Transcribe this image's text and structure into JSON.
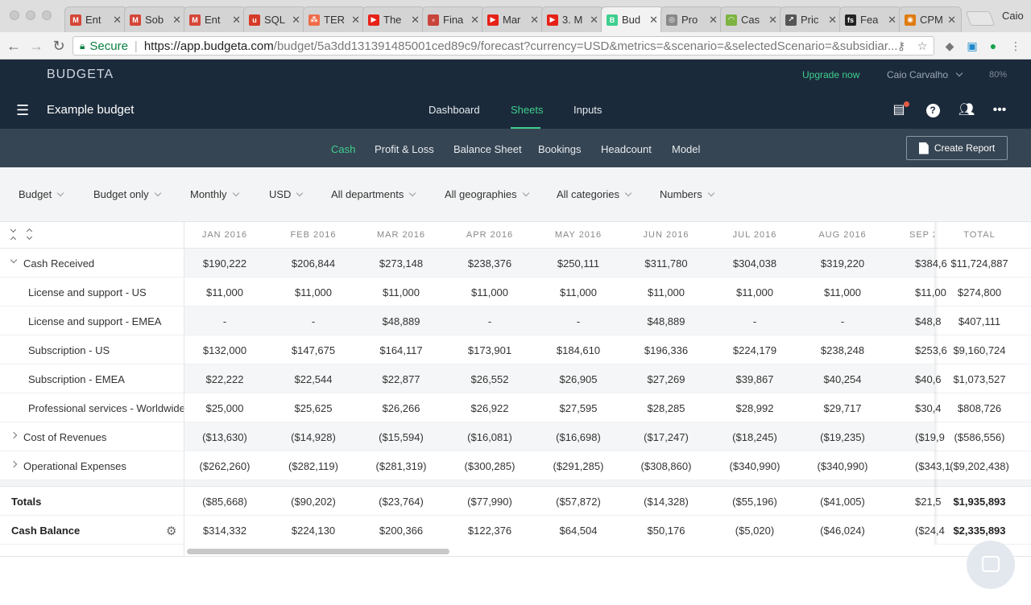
{
  "browser": {
    "tabs": [
      {
        "title": "Ent",
        "fav": "M",
        "color": "#d44638"
      },
      {
        "title": "Sob",
        "fav": "M",
        "color": "#d44638"
      },
      {
        "title": "Ent",
        "fav": "M",
        "color": "#d44638"
      },
      {
        "title": "SQL",
        "fav": "u",
        "color": "#d63a27"
      },
      {
        "title": "TER",
        "fav": "⁂",
        "color": "#ef6c4a"
      },
      {
        "title": "The",
        "fav": "▶",
        "color": "#e62117"
      },
      {
        "title": "Fina",
        "fav": "♆",
        "color": "#c8453a"
      },
      {
        "title": "Mar",
        "fav": "▶",
        "color": "#e62117"
      },
      {
        "title": "3. M",
        "fav": "▶",
        "color": "#e62117"
      },
      {
        "title": "Bud",
        "fav": "B",
        "color": "#3ecf8e"
      },
      {
        "title": "Pro",
        "fav": "◎",
        "color": "#888"
      },
      {
        "title": "Cas",
        "fav": "◠",
        "color": "#7cb342"
      },
      {
        "title": "Pric",
        "fav": "↗",
        "color": "#555"
      },
      {
        "title": "Fea",
        "fav": "fs",
        "color": "#222"
      },
      {
        "title": "CPM",
        "fav": "◉",
        "color": "#e07b12"
      }
    ],
    "profile_name": "Caio",
    "secure_label": "Secure",
    "url_host": "https://app.budgeta.com",
    "url_rest": "/budget/5a3dd131391485001ced89c9/forecast?currency=USD&metrics=&scenario=&selectedScenario=&subsidiar..."
  },
  "app": {
    "logo": "BUDGETA",
    "upgrade": "Upgrade now",
    "user": "Caio Carvalho",
    "zoom": "80%",
    "budget_title": "Example budget",
    "main_nav": [
      "Dashboard",
      "Sheets",
      "Inputs"
    ],
    "active_main_nav": "Sheets",
    "sheet_tabs": [
      "Cash",
      "Profit & Loss",
      "Balance Sheet",
      "Bookings",
      "Headcount",
      "Model"
    ],
    "active_sheet_tab": "Cash",
    "create_report": "Create Report"
  },
  "filters": [
    "Budget",
    "Budget only",
    "Monthly",
    "USD",
    "All departments",
    "All geographies",
    "All categories",
    "Numbers"
  ],
  "table": {
    "columns": [
      "JAN 2016",
      "FEB 2016",
      "MAR 2016",
      "APR 2016",
      "MAY 2016",
      "JUN 2016",
      "JUL 2016",
      "AUG 2016",
      "SEP 20"
    ],
    "total_header": "TOTAL",
    "rows": [
      {
        "label": "Cash Received",
        "level": 0,
        "expander": "open",
        "values": [
          "$190,222",
          "$206,844",
          "$273,148",
          "$238,376",
          "$250,111",
          "$311,780",
          "$304,038",
          "$319,220",
          "$384,6"
        ],
        "total": "$11,724,887"
      },
      {
        "label": "License and support - US",
        "level": 1,
        "expander": "none",
        "values": [
          "$11,000",
          "$11,000",
          "$11,000",
          "$11,000",
          "$11,000",
          "$11,000",
          "$11,000",
          "$11,000",
          "$11,00"
        ],
        "total": "$274,800"
      },
      {
        "label": "License and support - EMEA",
        "level": 1,
        "expander": "none",
        "values": [
          "-",
          "-",
          "$48,889",
          "-",
          "-",
          "$48,889",
          "-",
          "-",
          "$48,8"
        ],
        "total": "$407,111"
      },
      {
        "label": "Subscription - US",
        "level": 1,
        "expander": "none",
        "values": [
          "$132,000",
          "$147,675",
          "$164,117",
          "$173,901",
          "$184,610",
          "$196,336",
          "$224,179",
          "$238,248",
          "$253,6"
        ],
        "total": "$9,160,724"
      },
      {
        "label": "Subscription - EMEA",
        "level": 1,
        "expander": "none",
        "values": [
          "$22,222",
          "$22,544",
          "$22,877",
          "$26,552",
          "$26,905",
          "$27,269",
          "$39,867",
          "$40,254",
          "$40,6"
        ],
        "total": "$1,073,527"
      },
      {
        "label": "Professional services - Worldwide",
        "level": 1,
        "expander": "none",
        "values": [
          "$25,000",
          "$25,625",
          "$26,266",
          "$26,922",
          "$27,595",
          "$28,285",
          "$28,992",
          "$29,717",
          "$30,4"
        ],
        "total": "$808,726"
      },
      {
        "label": "Cost of Revenues",
        "level": 0,
        "expander": "closed",
        "values": [
          "($13,630)",
          "($14,928)",
          "($15,594)",
          "($16,081)",
          "($16,698)",
          "($17,247)",
          "($18,245)",
          "($19,235)",
          "($19,9"
        ],
        "total": "($586,556)"
      },
      {
        "label": "Operational Expenses",
        "level": 0,
        "expander": "closed",
        "values": [
          "($262,260)",
          "($282,119)",
          "($281,319)",
          "($300,285)",
          "($291,285)",
          "($308,860)",
          "($340,990)",
          "($340,990)",
          "($343,1"
        ],
        "total": "($9,202,438)"
      }
    ],
    "summary_rows": [
      {
        "label": "Totals",
        "values": [
          "($85,668)",
          "($90,202)",
          "($23,764)",
          "($77,990)",
          "($57,872)",
          "($14,328)",
          "($55,196)",
          "($41,005)",
          "$21,5"
        ],
        "total": "$1,935,893"
      },
      {
        "label": "Cash Balance",
        "values": [
          "$314,332",
          "$224,130",
          "$200,366",
          "$122,376",
          "$64,504",
          "$50,176",
          "($5,020)",
          "($46,024)",
          "($24,4"
        ],
        "total": "$2,335,893"
      }
    ]
  }
}
